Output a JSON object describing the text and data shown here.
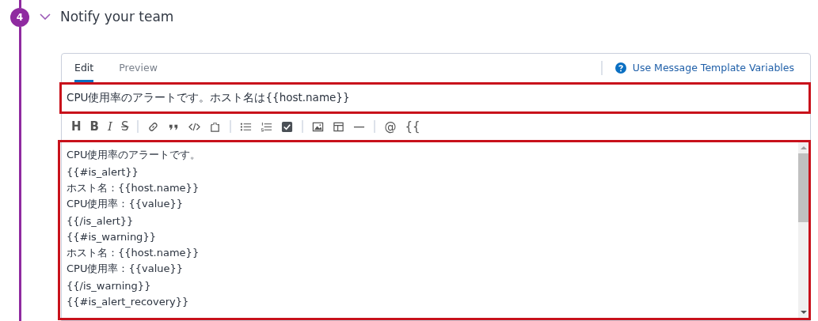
{
  "step": {
    "number": "4",
    "title": "Notify your team",
    "expanded": true
  },
  "tabs": [
    {
      "label": "Edit",
      "selected": true
    },
    {
      "label": "Preview",
      "selected": false
    }
  ],
  "help_link": {
    "label": "Use Message Template Variables"
  },
  "title_field": {
    "value": "CPU使用率のアラートです。ホスト名は{{host.name}}",
    "highlighted": true
  },
  "toolbar": [
    [
      {
        "kind": "heading",
        "label": "H"
      },
      {
        "kind": "bold",
        "label": "B"
      },
      {
        "kind": "italic",
        "label": "I"
      },
      {
        "kind": "strike",
        "label": "S"
      }
    ],
    [
      {
        "kind": "link"
      },
      {
        "kind": "quote"
      },
      {
        "kind": "code"
      },
      {
        "kind": "embed"
      }
    ],
    [
      {
        "kind": "bullets"
      },
      {
        "kind": "numbers"
      },
      {
        "kind": "checkbox"
      }
    ],
    [
      {
        "kind": "image"
      },
      {
        "kind": "table"
      },
      {
        "kind": "rule"
      }
    ],
    [
      {
        "kind": "mention",
        "label": "@"
      },
      {
        "kind": "variable",
        "label": "{{"
      }
    ]
  ],
  "body_field": {
    "highlighted": true,
    "lines": [
      "CPU使用率のアラートです。",
      "{{#is_alert}}",
      "ホスト名：{{host.name}}",
      "CPU使用率：{{value}}",
      "{{/is_alert}}",
      "{{#is_warning}}",
      "ホスト名：{{host.name}}",
      "CPU使用率：{{value}}",
      "{{/is_warning}}",
      "{{#is_alert_recovery}}"
    ]
  }
}
